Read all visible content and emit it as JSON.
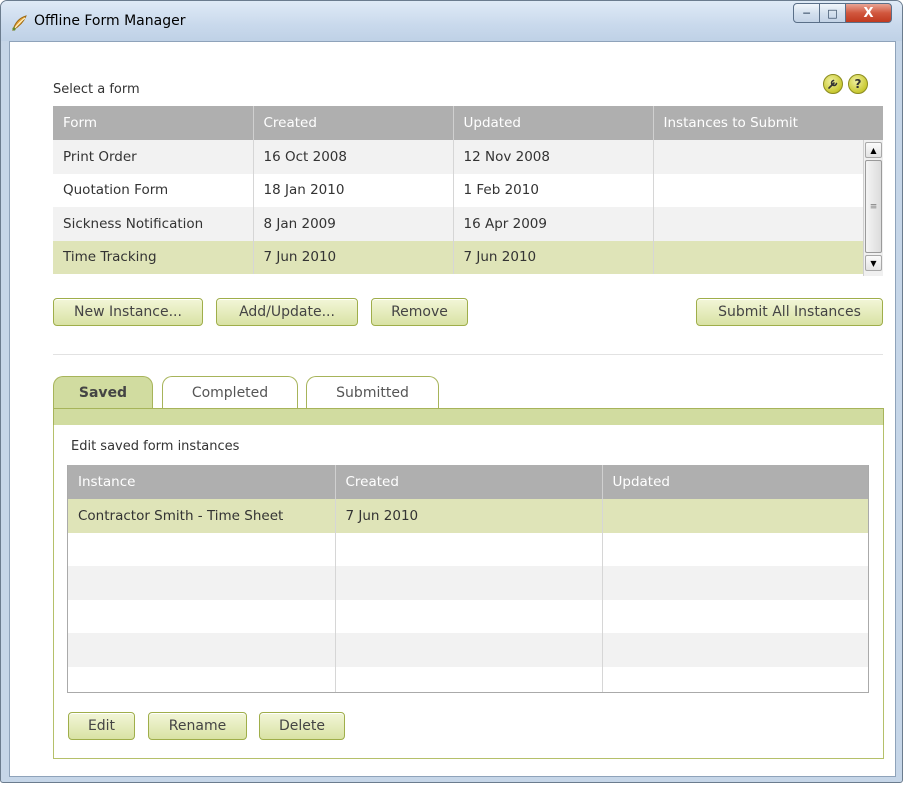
{
  "window": {
    "title": "Offline Form Manager",
    "controls": {
      "minimize": "─",
      "maximize": "□",
      "close": "X"
    }
  },
  "forms_section": {
    "label": "Select a form",
    "icons": [
      "wrench-icon",
      "help-icon"
    ],
    "help_glyph": "?",
    "columns": [
      "Form",
      "Created",
      "Updated",
      "Instances to Submit"
    ],
    "rows": [
      {
        "form": "Print Order",
        "created": "16 Oct 2008",
        "updated": "12 Nov 2008",
        "instances": ""
      },
      {
        "form": "Quotation Form",
        "created": "18 Jan 2010",
        "updated": "1 Feb 2010",
        "instances": ""
      },
      {
        "form": "Sickness Notification",
        "created": "8 Jan 2009",
        "updated": "16 Apr 2009",
        "instances": ""
      },
      {
        "form": "Time Tracking",
        "created": "7 Jun 2010",
        "updated": "7 Jun 2010",
        "instances": ""
      }
    ],
    "selected_row": 3,
    "buttons": {
      "new_instance": "New Instance...",
      "add_update": "Add/Update...",
      "remove": "Remove",
      "submit_all": "Submit All Instances"
    }
  },
  "tabs": {
    "items": [
      "Saved",
      "Completed",
      "Submitted"
    ],
    "active": 0
  },
  "instances_section": {
    "label": "Edit saved form instances",
    "columns": [
      "Instance",
      "Created",
      "Updated"
    ],
    "rows": [
      {
        "instance": "Contractor Smith - Time Sheet",
        "created": "7 Jun 2010",
        "updated": ""
      }
    ],
    "selected_row": 0,
    "buttons": {
      "edit": "Edit",
      "rename": "Rename",
      "delete": "Delete"
    }
  },
  "colors": {
    "accent": "#d1dca0",
    "selection": "#dfe4b8",
    "header_gray": "#afafaf",
    "button_border": "#9fae4a"
  }
}
